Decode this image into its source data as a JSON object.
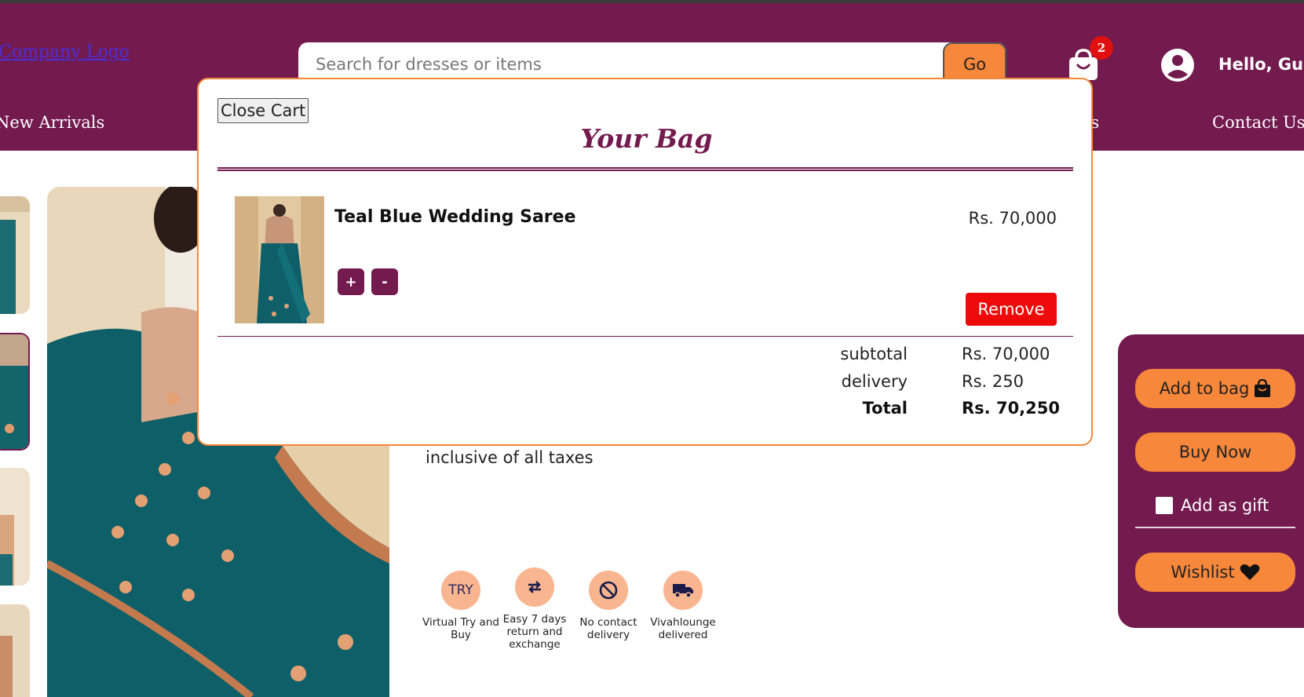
{
  "header": {
    "logo_text": "Company Logo",
    "search_placeholder": "Search for dresses or items",
    "go_label": "Go",
    "bag_count": "2",
    "greeting": "Hello, Guest",
    "nav": {
      "new_arrivals": "New Arrivals",
      "partial": "es",
      "contact": "Contact Us"
    }
  },
  "product": {
    "taxes_note": "inclusive of all taxes",
    "features": [
      {
        "icon": "try-icon",
        "icon_text": "TRY",
        "caption": "Virtual Try and Buy"
      },
      {
        "icon": "exchange-arrows-icon",
        "caption": "Easy 7 days return and exchange"
      },
      {
        "icon": "no-contact-icon",
        "caption": "No contact delivery"
      },
      {
        "icon": "truck-icon",
        "caption": "Vivahlounge delivered"
      }
    ]
  },
  "side_panel": {
    "add_to_bag": "Add to bag",
    "buy_now": "Buy Now",
    "gift_label": "Add as gift",
    "wishlist": "Wishlist"
  },
  "cart": {
    "close_label": "Close Cart",
    "title": "Your Bag",
    "items": [
      {
        "name": "Teal Blue Wedding Saree",
        "price": "Rs. 70,000",
        "plus": "+",
        "minus": "-",
        "remove": "Remove"
      }
    ],
    "summary": {
      "subtotal_label": "subtotal",
      "subtotal_value": "Rs. 70,000",
      "delivery_label": "delivery",
      "delivery_value": "Rs. 250",
      "total_label": "Total",
      "total_value": "Rs. 70,250"
    }
  },
  "colors": {
    "brand": "#731a4e",
    "accent": "#f7873a",
    "danger": "#ee0a0a"
  }
}
